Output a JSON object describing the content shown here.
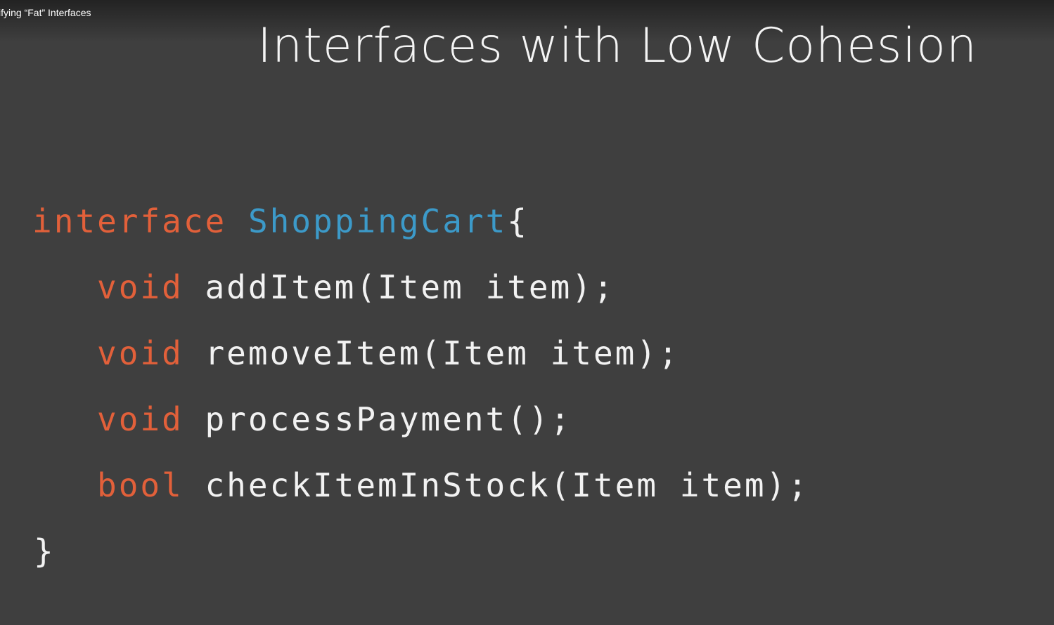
{
  "video": {
    "title": "ifying “Fat” Interfaces"
  },
  "slide": {
    "title": "Interfaces with Low Cohesion"
  },
  "code": {
    "header": {
      "keyword": "interface",
      "name": "ShoppingCart",
      "brace": "{"
    },
    "methods": [
      {
        "type": "void",
        "signature": "addItem(Item item);"
      },
      {
        "type": "void",
        "signature": "removeItem(Item item);"
      },
      {
        "type": "void",
        "signature": "processPayment();"
      },
      {
        "type": "bool",
        "signature": "checkItemInStock(Item item);"
      }
    ],
    "closing_brace": "}"
  },
  "colors": {
    "background": "#3f3f3f",
    "keyword": "#e2603a",
    "type_name": "#3c9ac9",
    "text": "#f2f2f2"
  }
}
